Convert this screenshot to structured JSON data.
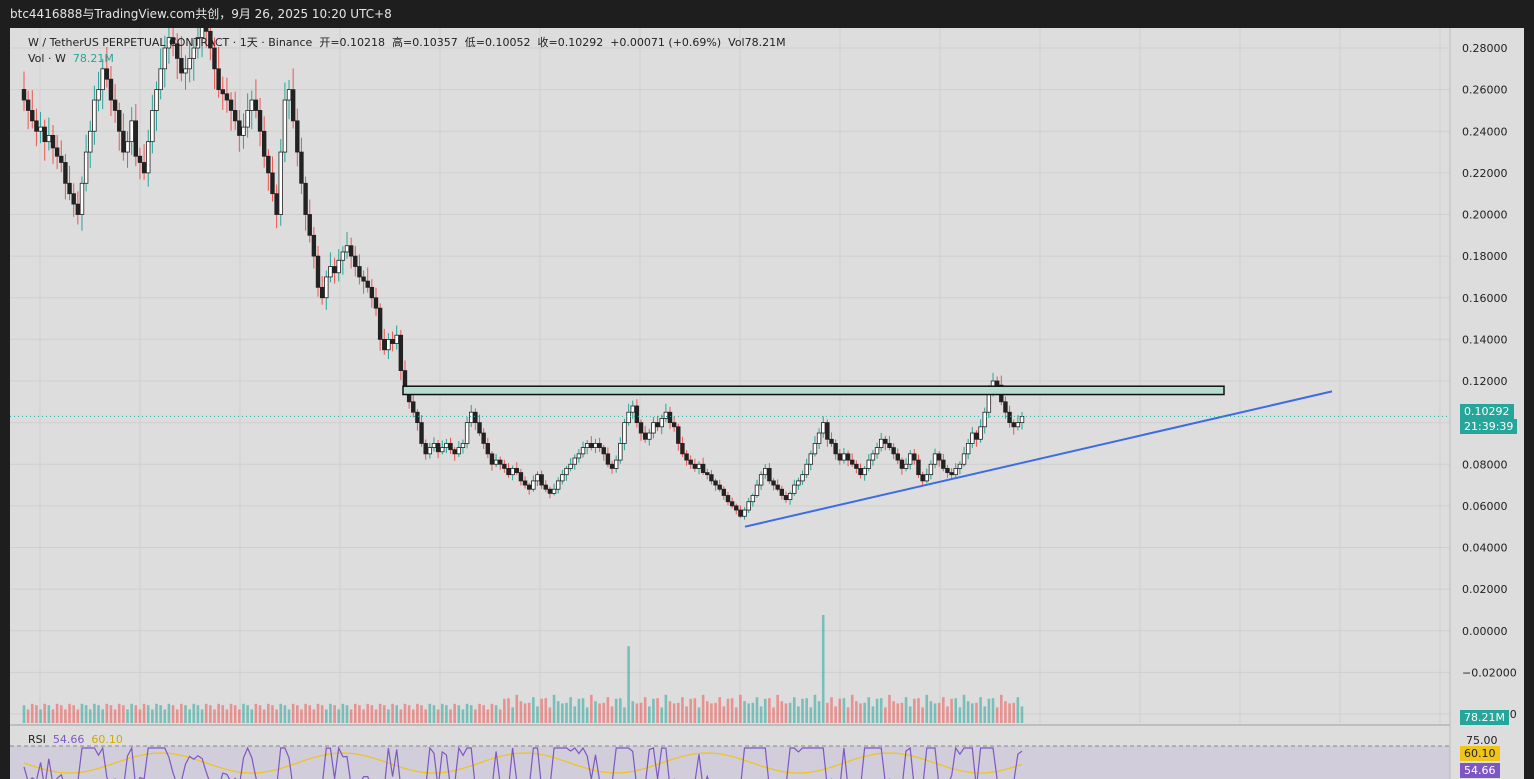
{
  "header": {
    "watermark": "btc4416888与TradingView.com共创，9月 26, 2025 10:20 UTC+8"
  },
  "legend": {
    "symbol": "W / TetherUS PERPETUAL CONTRACT · 1天 · Binance",
    "open_label": "开=0.10218",
    "high_label": "高=0.10357",
    "low_label": "低=0.10052",
    "close_label": "收=0.10292",
    "change": "+0.00071 (+0.69%)",
    "volume": "Vol78.21M",
    "vol_label": "Vol · W",
    "vol_value": "78.21M",
    "rsi_label": "RSI",
    "rsi_value": "54.66",
    "rsi_ma_value": "60.10"
  },
  "price_scale": {
    "ticks": [
      "0.28000",
      "0.26000",
      "0.24000",
      "0.22000",
      "0.20000",
      "0.18000",
      "0.16000",
      "0.14000",
      "0.12000",
      "0.10000",
      "0.08000",
      "0.06000",
      "0.04000",
      "0.02000",
      "0.00000",
      "−0.02000",
      "−0.04000"
    ]
  },
  "tags": {
    "last_price": "0.10292",
    "countdown": "21:39:39",
    "volume_tag": "78.21M",
    "rsi_level": "75.00",
    "rsi_ma_tag": "60.10",
    "rsi_tag": "54.66"
  },
  "colors": {
    "up": "#26a69a",
    "down": "#ef5350",
    "bg": "#dddddd",
    "trendline": "#3d6be0",
    "rsi": "#7e57c2",
    "rsi_ma": "#f0c419"
  },
  "chart_data": {
    "type": "candlestick",
    "interval": "1D",
    "ylim": [
      -0.045,
      0.29
    ],
    "close_series": [
      0.255,
      0.25,
      0.245,
      0.24,
      0.242,
      0.235,
      0.238,
      0.232,
      0.228,
      0.225,
      0.215,
      0.21,
      0.205,
      0.2,
      0.215,
      0.23,
      0.24,
      0.255,
      0.26,
      0.27,
      0.265,
      0.255,
      0.25,
      0.24,
      0.23,
      0.235,
      0.245,
      0.228,
      0.225,
      0.22,
      0.235,
      0.25,
      0.26,
      0.27,
      0.28,
      0.285,
      0.282,
      0.275,
      0.268,
      0.27,
      0.275,
      0.28,
      0.285,
      0.29,
      0.288,
      0.28,
      0.27,
      0.26,
      0.258,
      0.255,
      0.25,
      0.245,
      0.238,
      0.242,
      0.25,
      0.255,
      0.25,
      0.24,
      0.228,
      0.22,
      0.21,
      0.2,
      0.23,
      0.255,
      0.26,
      0.245,
      0.23,
      0.215,
      0.2,
      0.19,
      0.18,
      0.165,
      0.16,
      0.17,
      0.175,
      0.172,
      0.178,
      0.182,
      0.185,
      0.18,
      0.175,
      0.17,
      0.168,
      0.165,
      0.16,
      0.155,
      0.14,
      0.135,
      0.14,
      0.138,
      0.142,
      0.125,
      0.115,
      0.11,
      0.105,
      0.1,
      0.09,
      0.085,
      0.088,
      0.09,
      0.086,
      0.088,
      0.09,
      0.087,
      0.085,
      0.088,
      0.09,
      0.1,
      0.105,
      0.1,
      0.095,
      0.09,
      0.085,
      0.08,
      0.082,
      0.08,
      0.078,
      0.075,
      0.078,
      0.076,
      0.072,
      0.07,
      0.068,
      0.072,
      0.075,
      0.07,
      0.068,
      0.066,
      0.068,
      0.072,
      0.075,
      0.078,
      0.08,
      0.083,
      0.085,
      0.088,
      0.09,
      0.088,
      0.09,
      0.088,
      0.085,
      0.08,
      0.078,
      0.082,
      0.09,
      0.1,
      0.105,
      0.108,
      0.1,
      0.095,
      0.092,
      0.095,
      0.1,
      0.098,
      0.102,
      0.105,
      0.1,
      0.098,
      0.09,
      0.085,
      0.082,
      0.08,
      0.078,
      0.08,
      0.076,
      0.075,
      0.072,
      0.07,
      0.068,
      0.065,
      0.062,
      0.06,
      0.058,
      0.055,
      0.058,
      0.062,
      0.065,
      0.07,
      0.075,
      0.078,
      0.072,
      0.07,
      0.068,
      0.065,
      0.063,
      0.066,
      0.07,
      0.072,
      0.075,
      0.08,
      0.085,
      0.09,
      0.095,
      0.1,
      0.092,
      0.09,
      0.085,
      0.082,
      0.085,
      0.082,
      0.08,
      0.078,
      0.075,
      0.078,
      0.082,
      0.085,
      0.088,
      0.092,
      0.09,
      0.088,
      0.085,
      0.082,
      0.078,
      0.08,
      0.085,
      0.082,
      0.075,
      0.072,
      0.075,
      0.08,
      0.085,
      0.082,
      0.078,
      0.076,
      0.075,
      0.078,
      0.08,
      0.085,
      0.09,
      0.095,
      0.092,
      0.098,
      0.105,
      0.115,
      0.12,
      0.118,
      0.11,
      0.105,
      0.1,
      0.098,
      0.1,
      0.103
    ],
    "horizontal_zone": [
      0.1135,
      0.1175
    ],
    "trendline": {
      "start": 0.05,
      "end": 0.115
    },
    "volume_spikes": [
      0.7,
      0.32,
      0.45,
      0.5
    ],
    "rsi": {
      "overbought": 75.0,
      "value": 54.66,
      "ma": 60.1
    }
  }
}
